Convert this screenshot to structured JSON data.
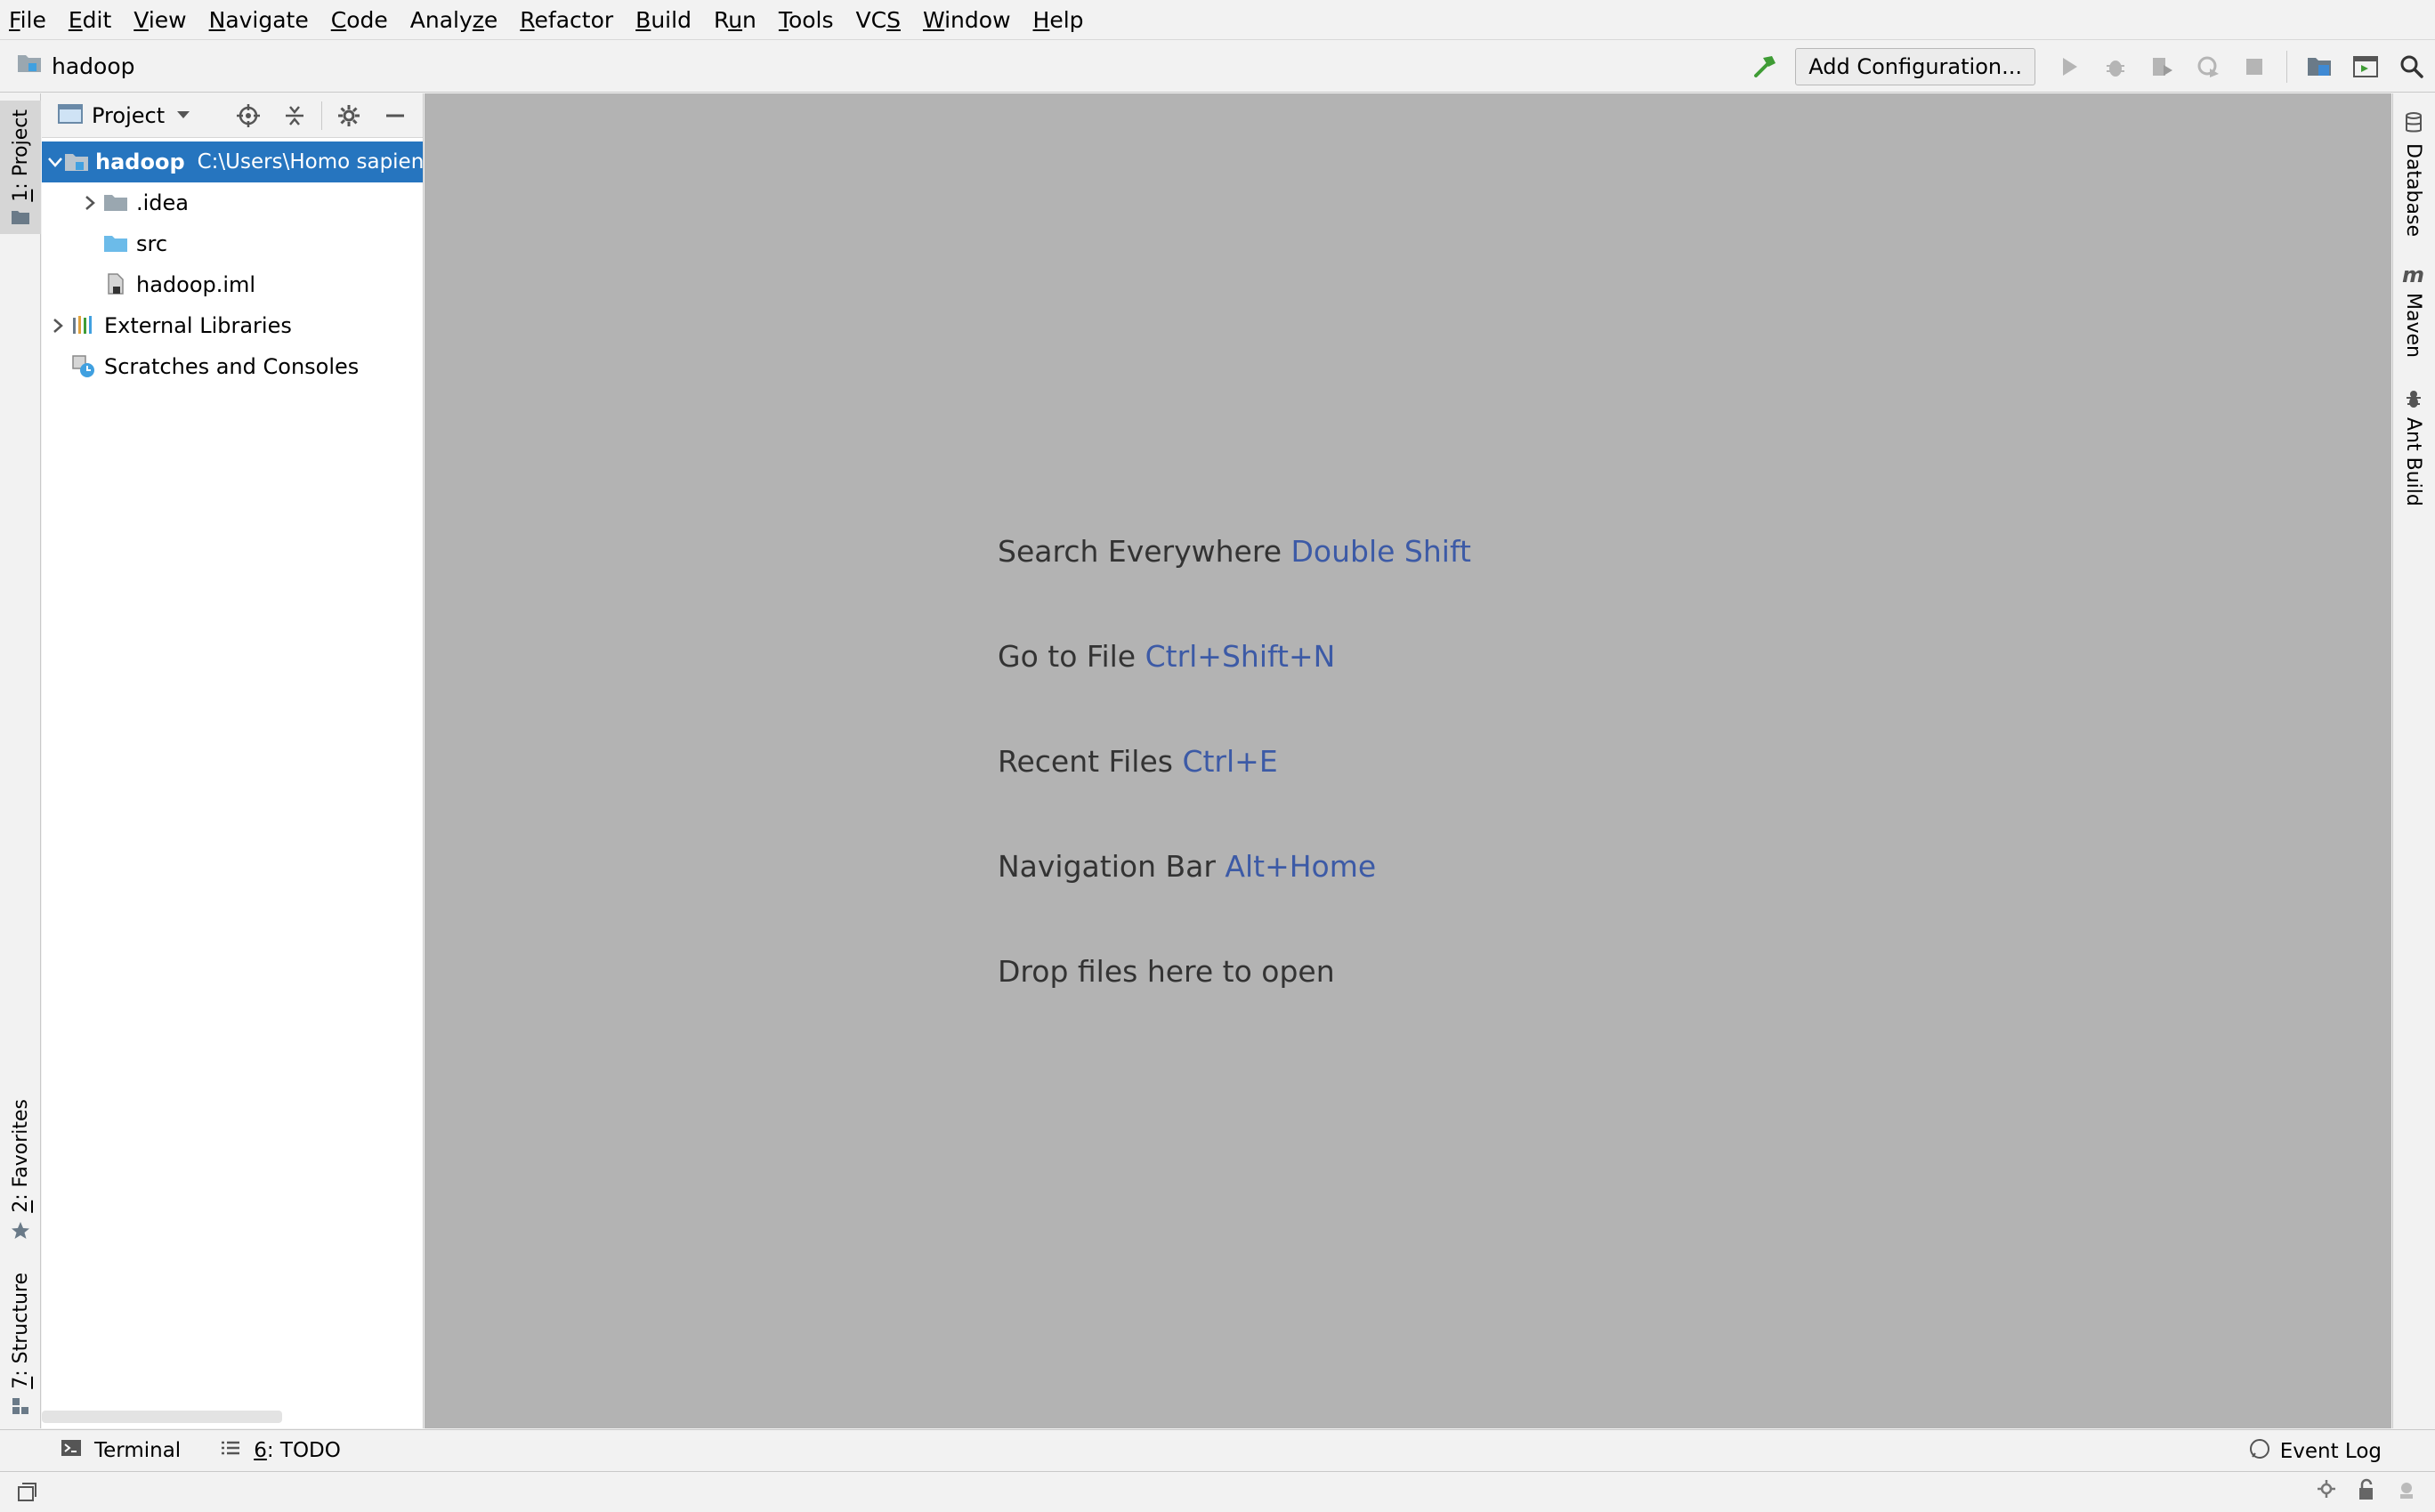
{
  "menu": [
    {
      "mnemonic": "F",
      "rest": "ile"
    },
    {
      "mnemonic": "E",
      "rest": "dit"
    },
    {
      "mnemonic": "V",
      "rest": "iew"
    },
    {
      "mnemonic": "N",
      "rest": "avigate"
    },
    {
      "mnemonic": "C",
      "rest": "ode"
    },
    {
      "pre": "Analy",
      "mnemonic": "z",
      "rest": "e"
    },
    {
      "mnemonic": "R",
      "rest": "efactor"
    },
    {
      "mnemonic": "B",
      "rest": "uild"
    },
    {
      "pre": "R",
      "mnemonic": "u",
      "rest": "n"
    },
    {
      "mnemonic": "T",
      "rest": "ools"
    },
    {
      "pre": "VC",
      "mnemonic": "S",
      "rest": ""
    },
    {
      "mnemonic": "W",
      "rest": "indow"
    },
    {
      "mnemonic": "H",
      "rest": "elp"
    }
  ],
  "navbar": {
    "project_name": "hadoop",
    "add_configuration": "Add Configuration..."
  },
  "left_stripe": {
    "project": {
      "num": "1",
      "label": ": Project"
    },
    "favorites": {
      "num": "2",
      "label": ": Favorites"
    },
    "structure": {
      "num": "7",
      "label": ": Structure"
    }
  },
  "project_panel": {
    "title": "Project",
    "tree": {
      "root_name": "hadoop",
      "root_path": "C:\\Users\\Homo sapiens",
      "idea": ".idea",
      "src": "src",
      "iml": "hadoop.iml",
      "external_libraries": "External Libraries",
      "scratches": "Scratches and Consoles"
    }
  },
  "editor_hints": [
    {
      "text": "Search Everywhere ",
      "shortcut": "Double Shift"
    },
    {
      "text": "Go to File ",
      "shortcut": "Ctrl+Shift+N"
    },
    {
      "text": "Recent Files ",
      "shortcut": "Ctrl+E"
    },
    {
      "text": "Navigation Bar ",
      "shortcut": "Alt+Home"
    },
    {
      "text": "Drop files here to open",
      "shortcut": ""
    }
  ],
  "right_stripe": {
    "database": "Database",
    "maven": "Maven",
    "ant_build": "Ant Build"
  },
  "bottom_tools": {
    "terminal": "Terminal",
    "todo_num": "6",
    "todo_label": ": TODO",
    "event_log": "Event Log"
  },
  "colors": {
    "selection": "#2675bf",
    "editor_bg": "#b3b3b3",
    "shortcut": "#3c5aa6"
  }
}
